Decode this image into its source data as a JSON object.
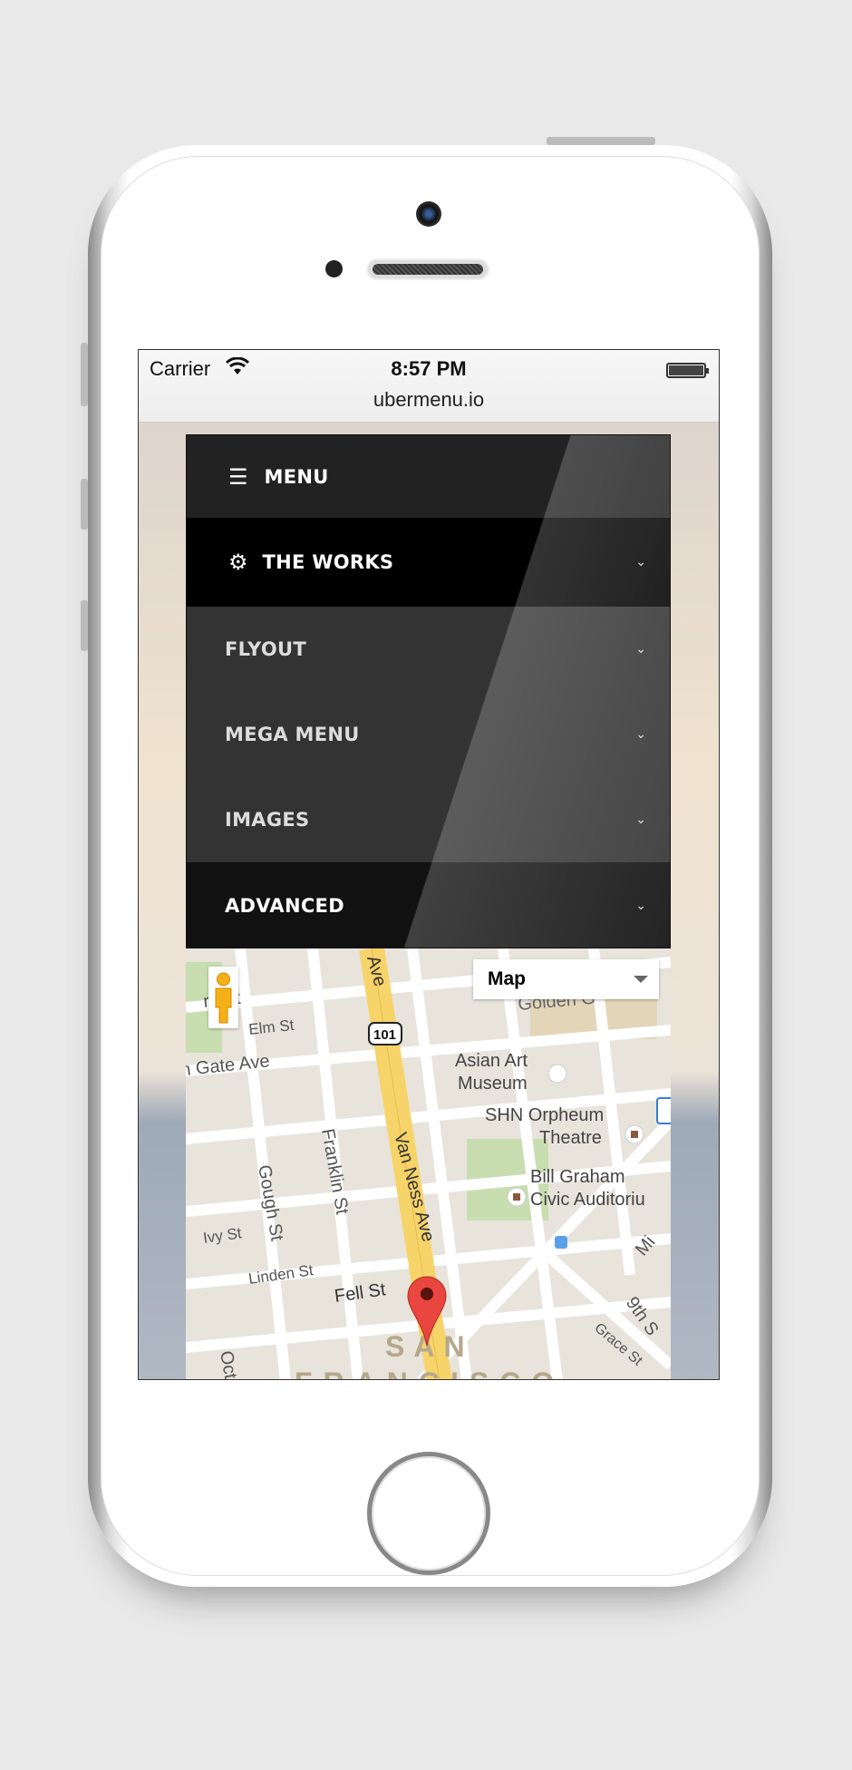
{
  "status_bar": {
    "carrier": "Carrier",
    "time": "8:57 PM",
    "url": "ubermenu.io"
  },
  "menu": {
    "toggle": {
      "label": "MENU",
      "icon": "hamburger-icon"
    },
    "items": [
      {
        "label": "THE WORKS",
        "icon": "gear-icon",
        "active": true
      },
      {
        "label": "FLYOUT"
      },
      {
        "label": "MEGA MENU"
      },
      {
        "label": "IMAGES"
      },
      {
        "label": "ADVANCED"
      }
    ],
    "chevron": "⌄"
  },
  "map": {
    "type_select": "Map",
    "labels": [
      "rk St",
      "Elm St",
      "n Gate Ave",
      "Ave",
      "St",
      "101",
      "Asian Art",
      "Museum",
      "SHN Orpheum",
      "Theatre",
      "Bill Graham",
      "Civic Auditoriu",
      "Gough St",
      "Franklin St",
      "Van Ness Ave",
      "Ivy St",
      "Linden St",
      "Fell St",
      "Golden G",
      "9th S",
      "Grace St",
      "Mi",
      "Oct",
      "SAN",
      "FRANCISCO"
    ],
    "colors": {
      "highway": "#f7d46a",
      "road": "#ffffff",
      "land": "#e8e4dc",
      "park": "#c9deb0",
      "pin": "#e8463e"
    }
  }
}
